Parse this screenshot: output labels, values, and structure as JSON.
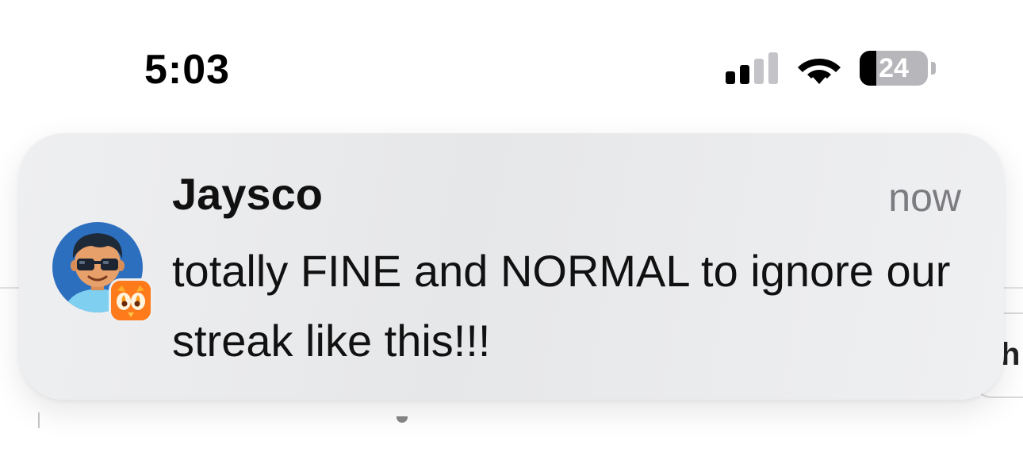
{
  "status_bar": {
    "time": "5:03",
    "battery_level": "24",
    "cellular_bars_active": 2,
    "cellular_bars_total": 4
  },
  "notification": {
    "sender": "Jaysco",
    "timestamp": "now",
    "message": "totally FINE and NORMAL to ignore our streak like this!!!",
    "app_icon": "duolingo-streak-flame-icon",
    "avatar_icon": "avatar-with-sunglasses"
  },
  "background": {
    "partial_button_text": "h"
  },
  "colors": {
    "avatar_bg": "#2d6fbf",
    "badge_bg": "#ff7a1a",
    "timestamp": "#7b7b80",
    "battery_level_bg": "#b7b7bb"
  }
}
